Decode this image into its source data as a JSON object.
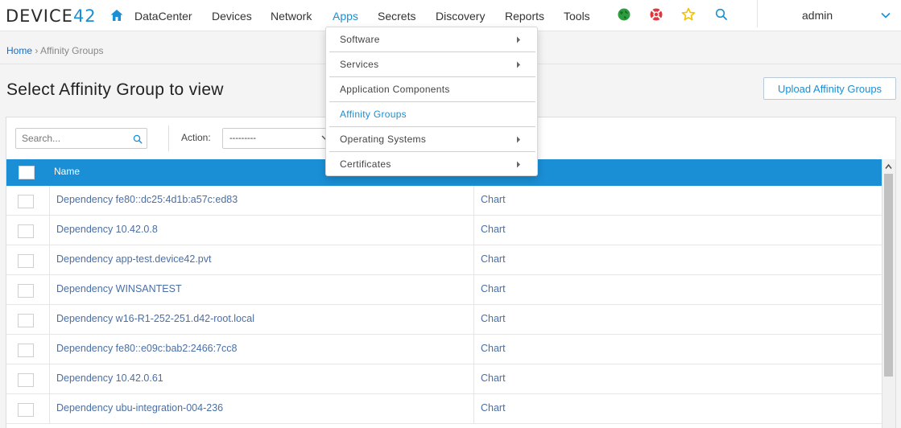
{
  "logo": {
    "text_main": "DEVICE",
    "text_accent": "42"
  },
  "nav": {
    "items": [
      {
        "label": "DataCenter"
      },
      {
        "label": "Devices"
      },
      {
        "label": "Network"
      },
      {
        "label": "Apps"
      },
      {
        "label": "Secrets"
      },
      {
        "label": "Discovery"
      },
      {
        "label": "Reports"
      },
      {
        "label": "Tools"
      }
    ],
    "active": "Apps",
    "icons": [
      "globe-icon",
      "lifebuoy-icon",
      "star-icon",
      "search-icon"
    ],
    "user": "admin"
  },
  "breadcrumb": {
    "home": "Home",
    "separator": "›",
    "current": "Affinity Groups"
  },
  "page": {
    "title": "Select Affinity Group to view",
    "upload_label": "Upload Affinity Groups"
  },
  "toolbar": {
    "search_placeholder": "Search...",
    "action_label": "Action:",
    "action_value": "---------"
  },
  "table": {
    "header_name": "Name",
    "rows": [
      {
        "name": "Dependency fe80::dc25:4d1b:a57c:ed83",
        "chart": "Chart"
      },
      {
        "name": "Dependency 10.42.0.8",
        "chart": "Chart"
      },
      {
        "name": "Dependency app-test.device42.pvt",
        "chart": "Chart"
      },
      {
        "name": "Dependency WINSANTEST",
        "chart": "Chart"
      },
      {
        "name": "Dependency w16-R1-252-251.d42-root.local",
        "chart": "Chart"
      },
      {
        "name": "Dependency fe80::e09c:bab2:2466:7cc8",
        "chart": "Chart"
      },
      {
        "name": "Dependency 10.42.0.61",
        "chart": "Chart"
      },
      {
        "name": "Dependency ubu-integration-004-236",
        "chart": "Chart"
      }
    ]
  },
  "apps_menu": {
    "items": [
      {
        "label": "Software",
        "submenu": true
      },
      {
        "label": "Services",
        "submenu": true
      },
      {
        "label": "Application Components",
        "submenu": false
      },
      {
        "label": "Affinity Groups",
        "submenu": false,
        "active": true
      },
      {
        "label": "Operating Systems",
        "submenu": true
      },
      {
        "label": "Certificates",
        "submenu": true
      }
    ]
  },
  "colors": {
    "accent": "#1a8fd6",
    "link": "#4a6fa5",
    "globe": "#2e9d3f",
    "lifebuoy": "#e0383e",
    "star": "#f2c200"
  }
}
